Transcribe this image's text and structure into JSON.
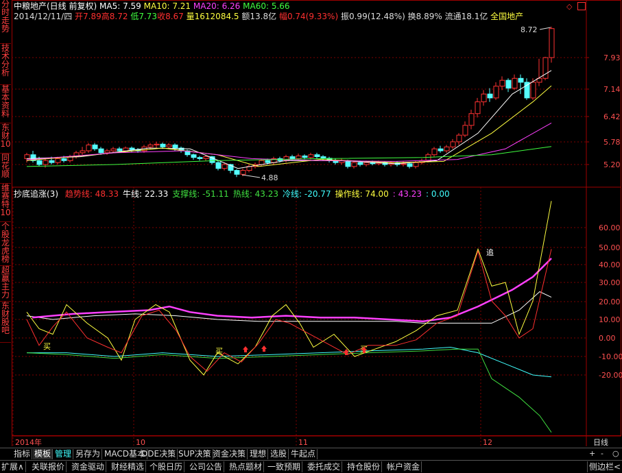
{
  "left_tabs": [
    "分时走势",
    "技术分析",
    "基本资料",
    "东财10",
    "同花顺",
    "维赛特10",
    "个股龙虎榜",
    "超赢主力",
    "东财股吧"
  ],
  "top_panel": {
    "title": "中粮地产(日线 前复权)",
    "ma5": "MA5: 7.59",
    "ma10": "MA10: 7.21",
    "ma20": "MA20: 6.26",
    "ma60": "MA60: 5.66",
    "date": "2014/12/11/四",
    "open": "开7.89",
    "high": "高8.72",
    "low": "低7.73",
    "close": "收8.67",
    "volume": "量1612084.5",
    "amount": "额13.8亿",
    "change": "幅0.74(9.33%)",
    "amplitude": "振0.99(12.48%)",
    "turnover": "换8.89%",
    "float": "流通18.1亿",
    "sector": "全国地产",
    "max_label": "8.72",
    "min_label": "4.88",
    "y_ticks": [
      "7.93",
      "7.14",
      "6.42",
      "5.78",
      "5.20"
    ]
  },
  "bottom_panel": {
    "title": "抄底追涨(3)",
    "items": [
      {
        "label": "趋势线: 48.33",
        "color": "#ff3030"
      },
      {
        "label": "牛线: 22.33",
        "color": "#ffffff"
      },
      {
        "label": "支撑线: -51.11",
        "color": "#40e040"
      },
      {
        "label": "热线: 43.23",
        "color": "#40e040"
      },
      {
        "label": "冷线: -20.77",
        "color": "#40ffff"
      },
      {
        "label": "操作线: 74.00",
        "color": "#ffff40"
      },
      {
        "label": ": 43.23",
        "color": "#ff40ff"
      },
      {
        "label": ": 0.00",
        "color": "#40ffff"
      }
    ],
    "y_ticks": [
      "60.00",
      "50.00",
      "40.00",
      "30.00",
      "20.00",
      "10.00",
      "0.00",
      "-10.00",
      "-20.00"
    ],
    "signal_chars": [
      "追",
      "买",
      "买",
      "买"
    ]
  },
  "x_axis": {
    "labels": [
      "2014年",
      "10",
      "11",
      "12"
    ],
    "period": "日线"
  },
  "colors": {
    "up": "#ff3232",
    "down": "#54ffff",
    "grid": "#800000",
    "axis": "#a00000"
  },
  "bottom_tabs_row1": [
    "指标",
    "模板",
    "管理",
    "另存为",
    "MACD基本",
    "DDE决策",
    "SUP决策",
    "资金决策",
    "理想",
    "选股",
    "牛起点"
  ],
  "bottom_tabs_row2": [
    "扩展∧",
    "关联报价",
    "资金驱动",
    "财经精选",
    "个股日历",
    "公司公告",
    "热点题材",
    "一致预期",
    "委托成交",
    "持仓股份",
    "帐户资金"
  ],
  "row2_right": "侧边栏<",
  "controls": [
    "+",
    "-",
    "○"
  ]
}
